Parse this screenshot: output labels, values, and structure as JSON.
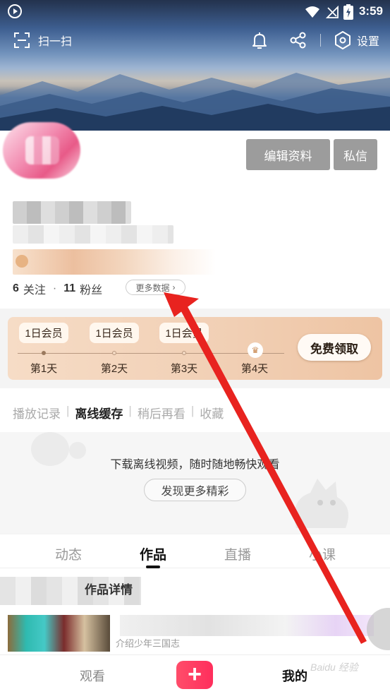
{
  "status_bar": {
    "time": "3:59"
  },
  "topnav": {
    "scan_label": "扫一扫",
    "settings_label": "设置"
  },
  "profile": {
    "edit_label": "编辑资料",
    "message_label": "私信",
    "following_count": "6",
    "following_label": "关注",
    "fans_count": "11",
    "fans_label": "粉丝",
    "more_data_label": "更多数据"
  },
  "vip_strip": {
    "days": [
      {
        "badge": "1日会员",
        "label": "第1天"
      },
      {
        "badge": "1日会员",
        "label": "第2天"
      },
      {
        "badge": "1日会员",
        "label": "第3天"
      },
      {
        "label": "第4天"
      }
    ],
    "claim_label": "免费领取"
  },
  "history": {
    "tabs": [
      "播放记录",
      "离线缓存",
      "稍后再看",
      "收藏"
    ],
    "active_tab_index": 1,
    "empty_message": "下载离线视频，随时随地畅快观看",
    "discover_label": "发现更多精彩"
  },
  "content_tabs": [
    "动态",
    "作品",
    "直播",
    "小课"
  ],
  "works": {
    "title": "作品详情",
    "desc": "介绍少年三国志"
  },
  "bottom_nav": {
    "watch": "观看",
    "plus": "+",
    "mine": "我的"
  },
  "watermark": "Baidu 经验",
  "colors": {
    "accent_pink": "#ff2e5c",
    "button_gray": "#9c9c9c",
    "vip_gold": "#f1cfb4",
    "annotation_red": "#e8231f"
  }
}
